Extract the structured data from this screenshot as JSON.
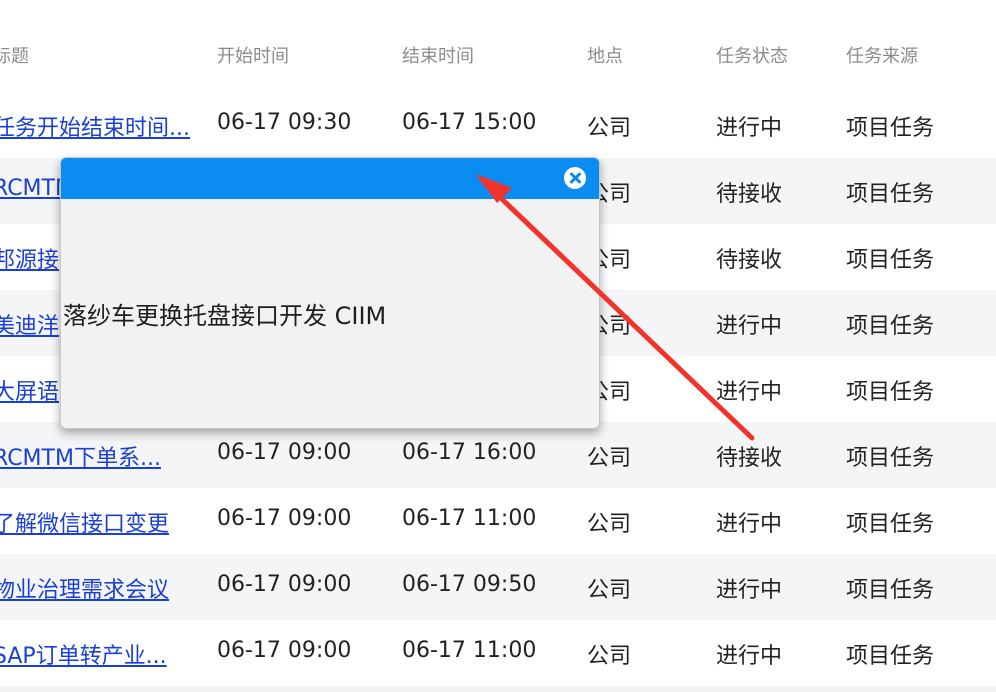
{
  "table": {
    "headers": {
      "title": "标题",
      "start": "开始时间",
      "end": "结束时间",
      "location": "地点",
      "status": "任务状态",
      "source": "任务来源"
    },
    "rows": [
      {
        "title": "任务开始结束时间...",
        "start": "06-17 09:30",
        "end": "06-17 15:00",
        "location": "公司",
        "status": "进行中",
        "source": "项目任务"
      },
      {
        "title": "RCMTM",
        "start": "",
        "end": "",
        "location": "公司",
        "status": "待接收",
        "source": "项目任务"
      },
      {
        "title": "邦源接",
        "start": "",
        "end": "",
        "location": "公司",
        "status": "待接收",
        "source": "项目任务"
      },
      {
        "title": "美迪洋",
        "start": "",
        "end": "",
        "location": "公司",
        "status": "进行中",
        "source": "项目任务"
      },
      {
        "title": "大屏语",
        "start": "",
        "end": "",
        "location": "公司",
        "status": "进行中",
        "source": "项目任务"
      },
      {
        "title": "RCMTM下单系...",
        "start": "06-17 09:00",
        "end": "06-17 16:00",
        "location": "公司",
        "status": "待接收",
        "source": "项目任务"
      },
      {
        "title": "了解微信接口变更",
        "start": "06-17 09:00",
        "end": "06-17 11:00",
        "location": "公司",
        "status": "进行中",
        "source": "项目任务"
      },
      {
        "title": "物业治理需求会议",
        "start": "06-17 09:00",
        "end": "06-17 09:50",
        "location": "公司",
        "status": "进行中",
        "source": "项目任务"
      },
      {
        "title": "SAP订单转产业...",
        "start": "06-17 09:00",
        "end": "06-17 11:00",
        "location": "公司",
        "status": "进行中",
        "source": "项目任务"
      }
    ]
  },
  "popup": {
    "content": "落纱车更换托盘接口开发 CIIM",
    "close_icon": "close-circle-icon",
    "header_color": "#0a8cf0"
  },
  "annotation": {
    "arrow_color": "#f2332b"
  }
}
